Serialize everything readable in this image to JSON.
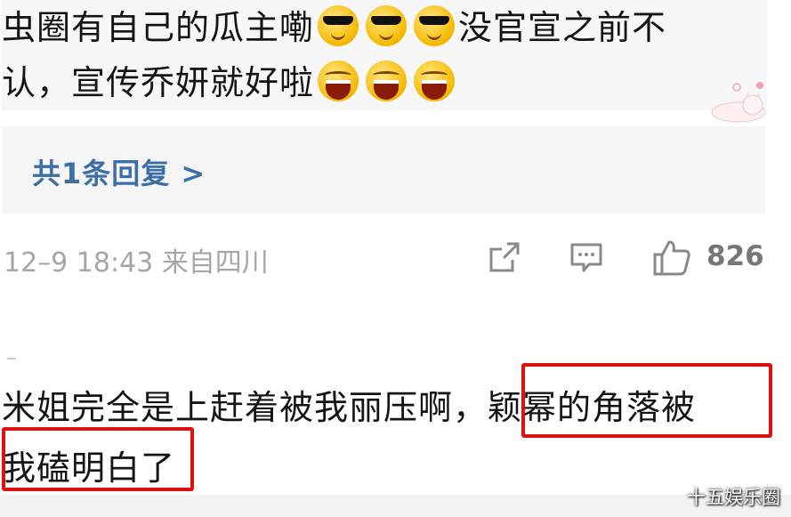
{
  "comment1": {
    "line1_text": "虫圈有自己的瓜主嘞",
    "line1_emojis": [
      "sunglasses-emoji",
      "sunglasses-emoji",
      "sunglasses-emoji"
    ],
    "line1_tail": "没官宣之前不",
    "line2_text": "认，宣传乔妍就好啦",
    "line2_emojis": [
      "laughing-emoji",
      "laughing-emoji",
      "laughing-emoji"
    ]
  },
  "reply": {
    "label": "共1条回复 >"
  },
  "meta": {
    "time": "12–9 18:43",
    "location": "来自四川",
    "likes": "826",
    "icons": [
      "share-icon",
      "comment-icon",
      "like-icon"
    ]
  },
  "comment2": {
    "line1_plain": "米姐完全是上赶着被我丽压啊，",
    "line1_highlight": "颖幂的角落被",
    "line2_highlight": "我磕明白了"
  },
  "colors": {
    "highlight": "#e01010",
    "link": "#3c6ea8",
    "meta": "#a6a6a6"
  },
  "watermark": "十五娱乐圈"
}
